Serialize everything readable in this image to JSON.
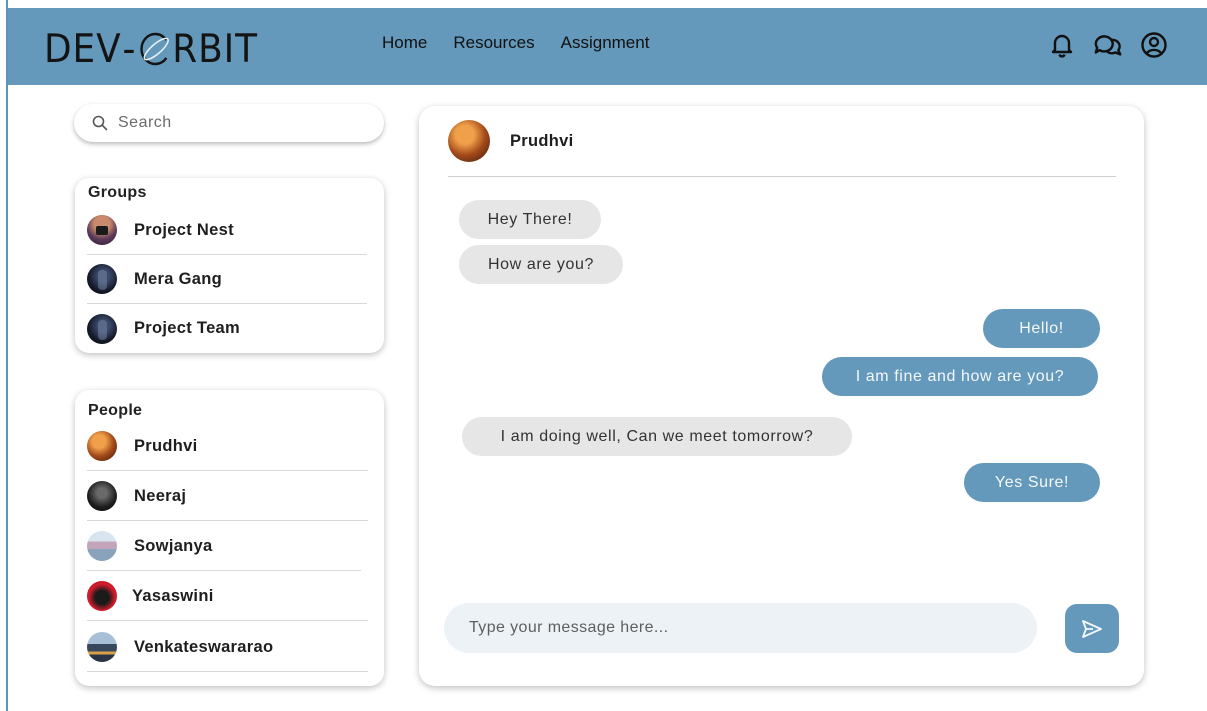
{
  "colors": {
    "accent": "#6499bb",
    "incoming_bubble": "#e6e6e6",
    "composer_bg": "#edf2f7"
  },
  "header": {
    "logo": {
      "left": "DEV",
      "dash": "-",
      "right": "RBIT"
    },
    "nav": [
      {
        "label": "Home"
      },
      {
        "label": "Resources"
      },
      {
        "label": "Assignment"
      }
    ],
    "icons": [
      "bell-icon",
      "chat-bubbles-icon",
      "user-account-icon"
    ]
  },
  "search": {
    "placeholder": "Search",
    "icon": "search-icon"
  },
  "groups": {
    "title": "Groups",
    "items": [
      {
        "name": "Project Nest"
      },
      {
        "name": "Mera Gang"
      },
      {
        "name": "Project Team"
      }
    ]
  },
  "people": {
    "title": "People",
    "items": [
      {
        "name": "Prudhvi"
      },
      {
        "name": "Neeraj"
      },
      {
        "name": "Sowjanya"
      },
      {
        "name": "Yasaswini"
      },
      {
        "name": "Venkateswararao"
      }
    ]
  },
  "chat": {
    "contact": "Prudhvi",
    "messages": [
      {
        "direction": "in",
        "text": "Hey There!"
      },
      {
        "direction": "in",
        "text": "How are you?"
      },
      {
        "direction": "out",
        "text": "Hello!"
      },
      {
        "direction": "out",
        "text": "I am fine and how are you?"
      },
      {
        "direction": "in",
        "text": "I am doing well, Can we meet tomorrow?"
      },
      {
        "direction": "out",
        "text": "Yes Sure!"
      }
    ],
    "composer": {
      "placeholder": "Type your message here...",
      "send_icon": "send-icon"
    }
  }
}
